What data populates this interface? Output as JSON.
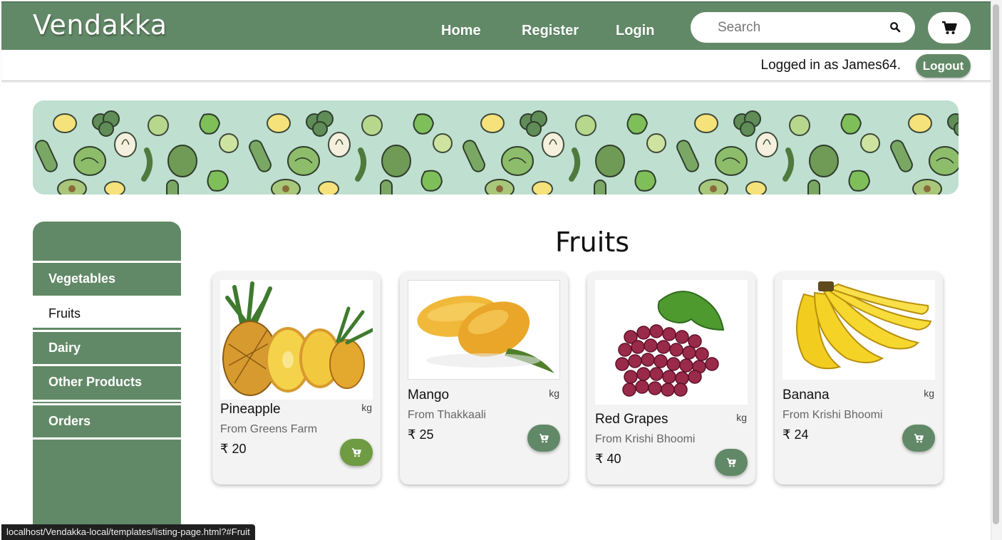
{
  "header": {
    "brand": "Vendakka",
    "nav": [
      {
        "label": "Home"
      },
      {
        "label": "Register"
      },
      {
        "label": "Login"
      }
    ],
    "search": {
      "placeholder": "Search",
      "value": ""
    },
    "icons": {
      "search": "search-icon",
      "cart": "cart-icon"
    }
  },
  "userbar": {
    "logged_in_text": "Logged in as James64.",
    "logout_label": "Logout"
  },
  "banner": {
    "pattern": "vegetable-pattern",
    "background": "#bfdfd0"
  },
  "sidebar": {
    "items": [
      {
        "label": "Vegetables",
        "active": false
      },
      {
        "label": "Fruits",
        "active": true
      },
      {
        "label": "Dairy",
        "active": false
      },
      {
        "label": "Other Products",
        "active": false
      },
      {
        "label": "Orders",
        "active": false
      }
    ]
  },
  "main": {
    "title": "Fruits",
    "products": [
      {
        "name": "Pineapple",
        "unit": "kg",
        "from": "From Greens Farm",
        "price": "₹ 20",
        "add_color": "#6f9b42",
        "image": "pineapple"
      },
      {
        "name": "Mango",
        "unit": "kg",
        "from": "From Thakkaali",
        "price": "₹ 25",
        "add_color": "#628967",
        "image": "mango"
      },
      {
        "name": "Red Grapes",
        "unit": "kg",
        "from": "From Krishi Bhoomi",
        "price": "₹ 40",
        "add_color": "#628967",
        "image": "red-grapes"
      },
      {
        "name": "Banana",
        "unit": "kg",
        "from": "From Krishi Bhoomi",
        "price": "₹ 24",
        "add_color": "#628967",
        "image": "banana"
      }
    ]
  },
  "statusbar": {
    "url": "localhost/Vendakka-local/templates/listing-page.html?#Fruit"
  },
  "colors": {
    "primary": "#628967",
    "accent_add": "#6f9b42"
  }
}
